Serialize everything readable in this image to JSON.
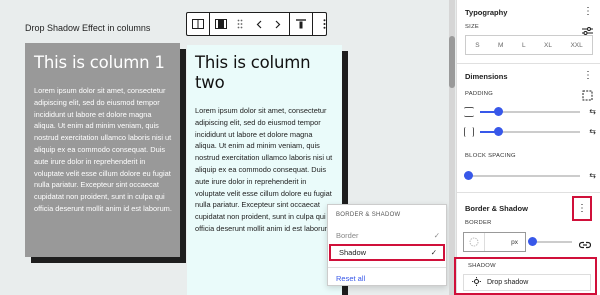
{
  "canvas": {
    "heading": "Drop Shadow Effect in columns",
    "columns": [
      {
        "title": "This is column 1",
        "body": "Lorem ipsum dolor sit amet, consectetur adipiscing elit, sed do eiusmod tempor incididunt ut labore et dolore magna aliqua. Ut enim ad minim veniam, quis nostrud exercitation ullamco laboris nisi ut aliquip ex ea commodo consequat. Duis aute irure dolor in reprehenderit in voluptate velit esse cillum dolore eu fugiat nulla pariatur. Excepteur sint occaecat cupidatat non proident, sunt in culpa qui officia deserunt mollit anim id est laborum."
      },
      {
        "title": "This is column two",
        "body": "Lorem ipsum dolor sit amet, consectetur adipiscing elit, sed do eiusmod tempor incididunt ut labore et dolore magna aliqua. Ut enim ad minim veniam, quis nostrud exercitation ullamco laboris nisi ut aliquip ex ea commodo consequat. Duis aute irure dolor in reprehenderit in voluptate velit esse cillum dolore eu fugiat nulla pariatur. Excepteur sint occaecat cupidatat non proident, sunt in culpa qui officia deserunt mollit anim id est laborum."
      }
    ],
    "dropdown": {
      "header": "BORDER & SHADOW",
      "items": [
        {
          "label": "Border",
          "check": "✓"
        },
        {
          "label": "Shadow",
          "check": "✓"
        }
      ],
      "reset": "Reset all"
    }
  },
  "sidebar": {
    "typography": {
      "title": "Typography",
      "size_label": "SIZE",
      "sizes": [
        "S",
        "M",
        "L",
        "XL",
        "XXL"
      ]
    },
    "dimensions": {
      "title": "Dimensions",
      "padding_label": "PADDING",
      "block_spacing_label": "BLOCK SPACING"
    },
    "border_shadow": {
      "title": "Border & Shadow",
      "border_label": "BORDER",
      "border_unit": "px",
      "shadow_label": "SHADOW",
      "shadow_option": "Drop shadow"
    }
  },
  "colors": {
    "highlight": "#d0103a",
    "accent": "#3858e9"
  }
}
